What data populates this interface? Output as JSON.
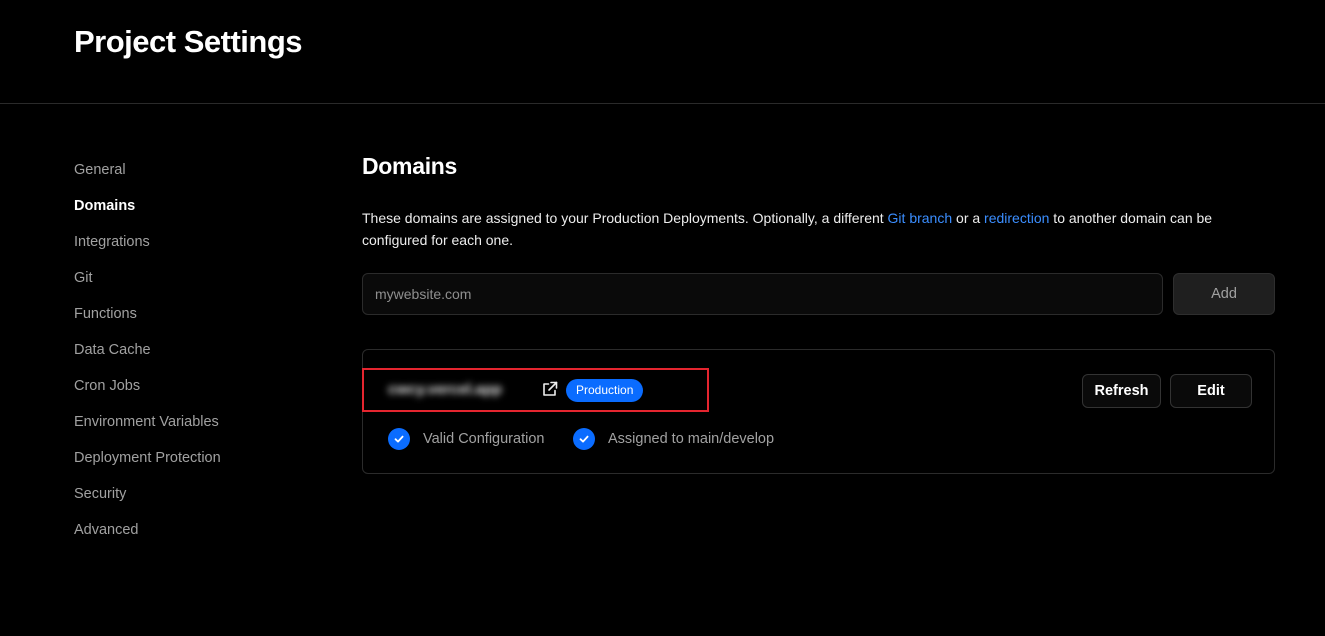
{
  "header": {
    "title": "Project Settings"
  },
  "sidebar": {
    "items": [
      {
        "label": "General",
        "active": false
      },
      {
        "label": "Domains",
        "active": true
      },
      {
        "label": "Integrations",
        "active": false
      },
      {
        "label": "Git",
        "active": false
      },
      {
        "label": "Functions",
        "active": false
      },
      {
        "label": "Data Cache",
        "active": false
      },
      {
        "label": "Cron Jobs",
        "active": false
      },
      {
        "label": "Environment Variables",
        "active": false
      },
      {
        "label": "Deployment Protection",
        "active": false
      },
      {
        "label": "Security",
        "active": false
      },
      {
        "label": "Advanced",
        "active": false
      }
    ]
  },
  "main": {
    "title": "Domains",
    "description": {
      "part1": "These domains are assigned to your Production Deployments. Optionally, a different ",
      "link1": "Git branch",
      "part2": " or a ",
      "link2": "redirection",
      "part3": " to another domain can be configured for each one."
    },
    "input": {
      "value": "",
      "placeholder": "mywebsite.com"
    },
    "add_label": "Add",
    "domain_card": {
      "domain": "cwcy.vercel.app",
      "badge": "Production",
      "refresh_label": "Refresh",
      "edit_label": "Edit",
      "checks": [
        {
          "label": "Valid Configuration",
          "icon": "check-circle-icon"
        },
        {
          "label": "Assigned to main/develop",
          "icon": "check-circle-icon"
        }
      ]
    }
  },
  "colors": {
    "background": "#000000",
    "accent": "#0a6cff",
    "link": "#3b8eff",
    "highlight": "#e5252f"
  }
}
